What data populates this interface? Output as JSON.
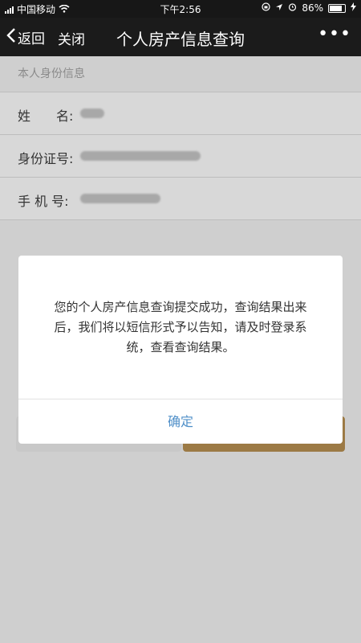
{
  "status": {
    "carrier": "中国移动",
    "time": "下午2:56",
    "battery": "86%",
    "battery_level": 0.86
  },
  "nav": {
    "back_label": "返回",
    "close_label": "关闭",
    "title": "个人房产信息查询",
    "more": "•••"
  },
  "form": {
    "section_title": "本人身份信息",
    "fields": [
      {
        "label": "姓　　名:"
      },
      {
        "label": "身份证号:"
      },
      {
        "label": "手  机  号:"
      }
    ]
  },
  "dialog": {
    "message": "您的个人房产信息查询提交成功，查询结果出来后，我们将以短信形式予以告知，请及时登录系统，查看查询结果。",
    "ok_label": "确定"
  },
  "colors": {
    "confirm": "#4f8fc8",
    "primary_button": "#c8a163"
  }
}
